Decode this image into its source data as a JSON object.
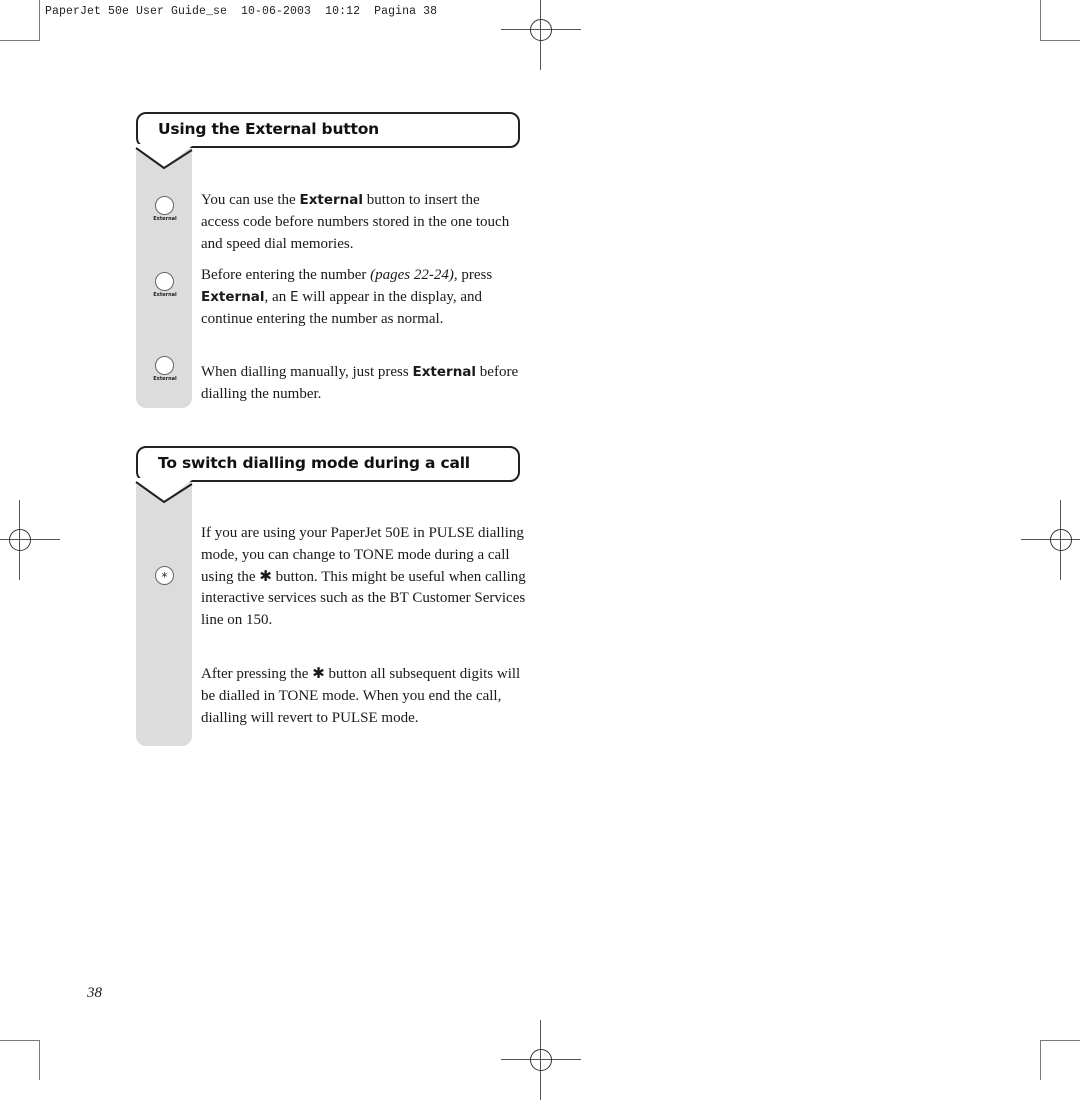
{
  "slug": {
    "doc_name": "PaperJet 50e User Guide_se",
    "date": "10-06-2003",
    "time": "10:12",
    "page_label": "Pagina 38"
  },
  "section1": {
    "title": "Using the External button",
    "key_label": "External",
    "paragraphs": [
      {
        "t1": "You can use the ",
        "b1": "External",
        "t2": " button to insert the access code before numbers stored in the one touch and speed dial memories."
      },
      {
        "t1": "Before entering the number ",
        "i1": "(pages 22-24)",
        "t2": ", press ",
        "b1": "External",
        "t3": ", an ",
        "s1": "E",
        "t4": " will appear in the display, and continue entering the number as normal."
      },
      {
        "t1": "When dialling manually, just press ",
        "b1": "External",
        "t2": " before dialling the number."
      }
    ]
  },
  "section2": {
    "title": "To switch dialling mode during a call",
    "key_symbol": "*",
    "paragraphs": [
      {
        "t1": "If you are using your PaperJet 50E in PULSE dialling mode, you can change to TONE mode during a call using the ",
        "sym": "✱",
        "t2": " button. This might be useful when calling interactive services such as the BT Customer Services line on 150."
      },
      {
        "t1": "After pressing the ",
        "sym": "✱",
        "t2": " button all subsequent digits will be dialled in TONE mode. When you end the call, dialling will revert to PULSE mode."
      }
    ]
  },
  "page_number": "38"
}
